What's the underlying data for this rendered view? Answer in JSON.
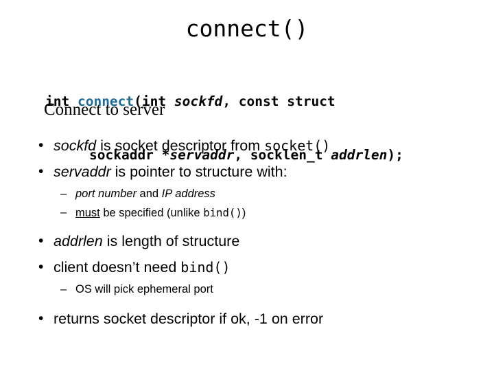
{
  "slide": {
    "title": "connect()",
    "signature": {
      "line1": {
        "pre": "int ",
        "fn": "connect",
        "open": "(int ",
        "param1": "sockfd",
        "mid": ", const struct"
      },
      "line2": {
        "pre": "sockaddr *",
        "param2": "servaddr",
        "mid": ", socklen_t ",
        "param3": "addrlen",
        "post": ");"
      },
      "fn_color": "#1f6d96"
    },
    "subtitle": "Connect to server",
    "bullets": [
      {
        "mark": "•",
        "parts": [
          {
            "text": "sockfd",
            "style": "italic"
          },
          {
            "text": " is socket descriptor from ",
            "style": "normal"
          },
          {
            "text": "socket()",
            "style": "mono"
          }
        ]
      },
      {
        "mark": "•",
        "parts": [
          {
            "text": "servaddr",
            "style": "italic"
          },
          {
            "text": " is pointer to structure with:",
            "style": "normal"
          }
        ]
      },
      {
        "mark": "•",
        "parts": [
          {
            "text": "addrlen",
            "style": "italic"
          },
          {
            "text": " is length of structure",
            "style": "normal"
          }
        ]
      },
      {
        "mark": "•",
        "parts": [
          {
            "text": "client doesn’t need ",
            "style": "normal"
          },
          {
            "text": "bind()",
            "style": "mono"
          }
        ]
      },
      {
        "mark": "•",
        "parts": [
          {
            "text": "returns socket descriptor if ok, -1 on error",
            "style": "normal"
          }
        ]
      }
    ],
    "sub_bullets_group1": [
      {
        "mark": "–",
        "parts": [
          {
            "text": "port number",
            "style": "italic"
          },
          {
            "text": " and ",
            "style": "normal"
          },
          {
            "text": "IP address",
            "style": "italic"
          }
        ]
      },
      {
        "mark": "–",
        "parts": [
          {
            "text": "must",
            "style": "underline"
          },
          {
            "text": " be specified (unlike ",
            "style": "normal"
          },
          {
            "text": "bind()",
            "style": "mono"
          },
          {
            "text": ")",
            "style": "normal"
          }
        ]
      }
    ],
    "sub_bullets_group2": [
      {
        "mark": "–",
        "parts": [
          {
            "text": "OS will pick ephemeral port",
            "style": "normal"
          }
        ]
      }
    ]
  }
}
